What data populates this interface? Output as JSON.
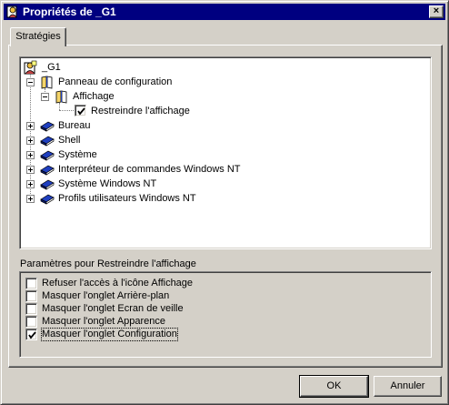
{
  "window": {
    "title": "Propriétés de _G1",
    "close_glyph": "×"
  },
  "tabs": [
    {
      "label": "Stratégies",
      "active": true
    }
  ],
  "tree": {
    "root": {
      "label": "_G1",
      "icon": "policy-user-icon"
    },
    "items": [
      {
        "label": "Panneau de configuration",
        "icon": "book-open-icon",
        "expander": "minus"
      },
      {
        "label": "Affichage",
        "icon": "book-open-icon",
        "expander": "minus"
      },
      {
        "label": "Restreindre l'affichage",
        "checked": true
      },
      {
        "label": "Bureau",
        "icon": "book-closed-icon",
        "expander": "plus"
      },
      {
        "label": "Shell",
        "icon": "book-closed-icon",
        "expander": "plus"
      },
      {
        "label": "Système",
        "icon": "book-closed-icon",
        "expander": "plus"
      },
      {
        "label": "Interpréteur de commandes Windows NT",
        "icon": "book-closed-icon",
        "expander": "plus"
      },
      {
        "label": "Système Windows NT",
        "icon": "book-closed-icon",
        "expander": "plus"
      },
      {
        "label": "Profils utilisateurs Windows NT",
        "icon": "book-closed-icon",
        "expander": "plus"
      }
    ]
  },
  "params": {
    "label": "Paramètres pour Restreindre l'affichage",
    "options": [
      {
        "label": "Refuser l'accès à l'icône Affichage",
        "checked": false
      },
      {
        "label": "Masquer l'onglet Arrière-plan",
        "checked": false
      },
      {
        "label": "Masquer l'onglet Ecran de veille",
        "checked": false
      },
      {
        "label": "Masquer l'onglet Apparence",
        "checked": false
      },
      {
        "label": "Masquer l'onglet Configuration",
        "checked": true,
        "focused": true
      }
    ]
  },
  "buttons": {
    "ok": "OK",
    "cancel": "Annuler"
  },
  "colors": {
    "titlebar": "#000080",
    "face": "#d4d0c8",
    "book": "#1f3fbf",
    "book_open": "#f4d46a"
  }
}
